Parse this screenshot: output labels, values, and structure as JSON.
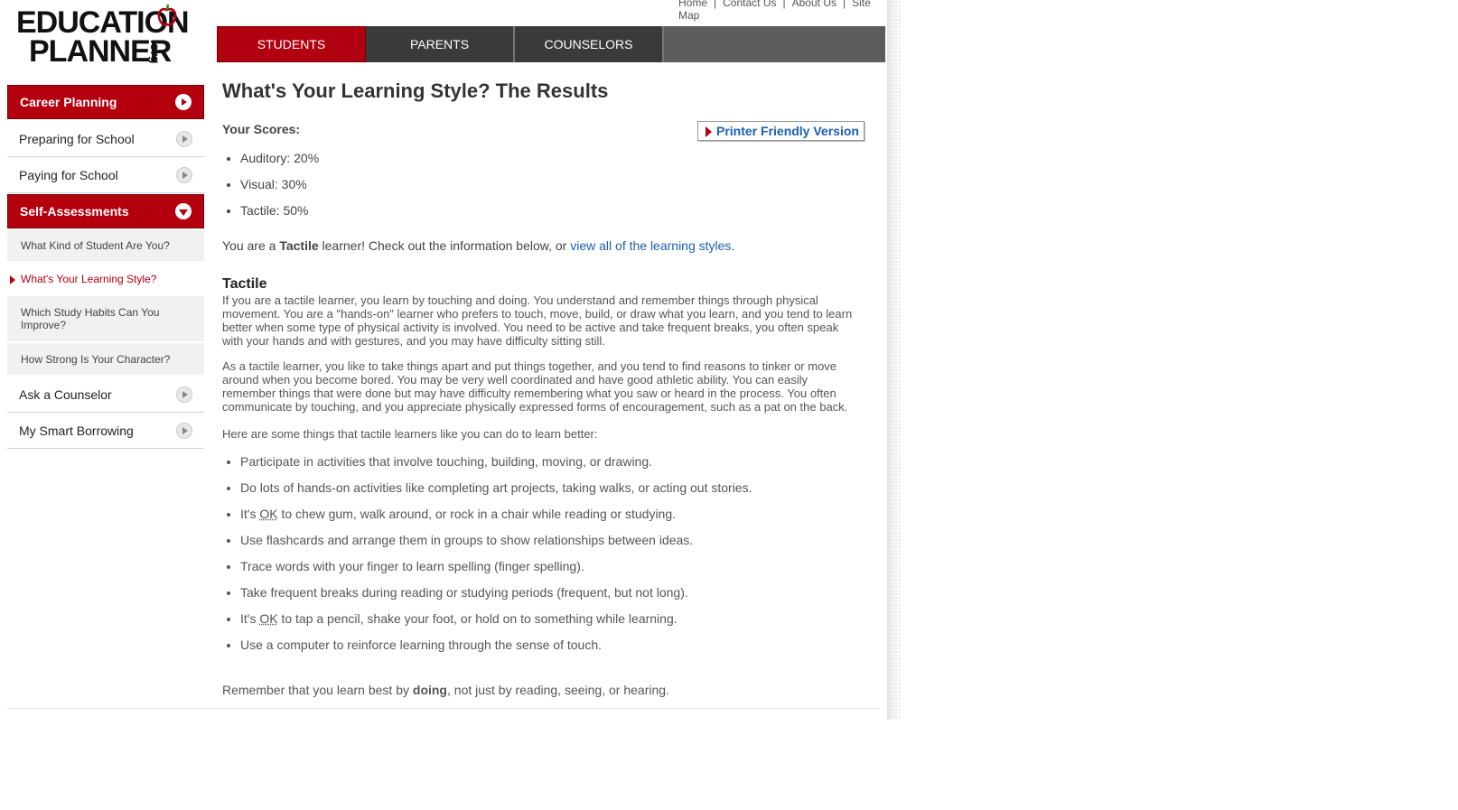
{
  "logo": {
    "line1": "EDUCATION",
    "line2": "PLANNER",
    "org": ".org"
  },
  "top_links": [
    "Home",
    "Contact Us",
    "About Us",
    "Site Map"
  ],
  "tabs": [
    {
      "label": "STUDENTS",
      "active": true
    },
    {
      "label": "PARENTS",
      "active": false
    },
    {
      "label": "COUNSELORS",
      "active": false
    }
  ],
  "sidebar": {
    "career_planning": "Career Planning",
    "preparing": "Preparing for School",
    "paying": "Paying for School",
    "self_assessments": "Self-Assessments",
    "sub": [
      "What Kind of Student Are You?",
      "What's Your Learning Style?",
      "Which Study Habits Can You Improve?",
      "How Strong Is Your Character?"
    ],
    "ask": "Ask a Counselor",
    "borrowing": "My Smart Borrowing"
  },
  "main": {
    "title": "What's Your Learning Style? The Results",
    "scores_label": "Your Scores:",
    "printer": "Printer Friendly Version",
    "scores": [
      {
        "label": "Auditory:",
        "value": "20%"
      },
      {
        "label": "Visual:",
        "value": "30%"
      },
      {
        "label": "Tactile:",
        "value": "50%"
      }
    ],
    "intro_pre": "You are a ",
    "intro_style": "Tactile",
    "intro_mid": " learner! Check out the information below, or ",
    "intro_link": "view all of the learning styles",
    "intro_end": ".",
    "section_title": "Tactile",
    "para1": "If you are a tactile learner, you learn by touching and doing. You understand and remember things through physical movement. You are a \"hands-on\" learner who prefers to touch, move, build, or draw what you learn, and you tend to learn better when some type of physical activity is involved. You need to be active and take frequent breaks, you often speak with your hands and with gestures, and you may have difficulty sitting still.",
    "para2": "As a tactile learner, you like to take things apart and put things together, and you tend to find reasons to tinker or move around when you become bored. You may be very well coordinated and have good athletic ability. You can easily remember things that were done but may have difficulty remembering what you saw or heard in the process. You often communicate by touching, and you appreciate physically expressed forms of encouragement, such as a pat on the back.",
    "para3": "Here are some things that tactile learners like you can do to learn better:",
    "tips": [
      "Participate in activities that involve touching, building, moving, or drawing.",
      "Do lots of hands-on activities like completing art projects, taking walks, or acting out stories.",
      "to chew gum, walk around, or rock in a chair while reading or studying.",
      "Use flashcards and arrange them in groups to show relationships between ideas.",
      "Trace words with your finger to learn spelling (finger spelling).",
      "Take frequent breaks during reading or studying periods (frequent, but not long).",
      "to tap a pencil, shake your foot, or hold on to something while learning.",
      "Use a computer to reinforce learning through the sense of touch."
    ],
    "its": "It's",
    "ok": "OK",
    "closing_pre": "Remember that you learn best by ",
    "closing_bold": "doing",
    "closing_end": ", not just by reading, seeing, or hearing."
  },
  "colors": {
    "brand_red": "#b4000e",
    "link_blue": "#1a5fb4",
    "tab_dark": "#3a3a3a"
  }
}
